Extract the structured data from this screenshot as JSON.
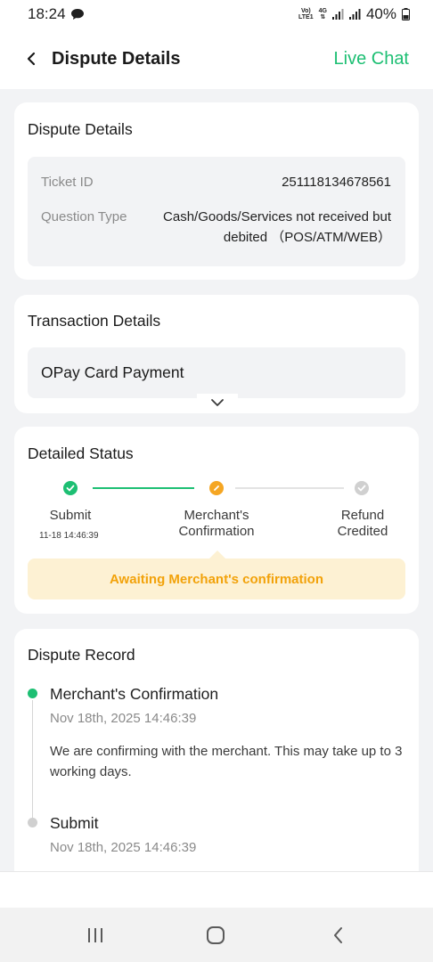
{
  "status_bar": {
    "time": "18:24",
    "network_top": "Vo)",
    "network_bottom": "LTE1",
    "network_type": "4G",
    "battery": "40%"
  },
  "header": {
    "title": "Dispute Details",
    "live_chat": "Live Chat",
    "accent_color": "#1dbf73"
  },
  "dispute": {
    "title": "Dispute Details",
    "ticket_label": "Ticket ID",
    "ticket_value": "251118134678561",
    "question_label": "Question Type",
    "question_value": "Cash/Goods/Services not received but debited （POS/ATM/WEB）"
  },
  "transaction": {
    "title": "Transaction Details",
    "item": "OPay Card Payment"
  },
  "status": {
    "title": "Detailed Status",
    "steps": [
      {
        "label": "Submit",
        "time": "11-18 14:46:39",
        "state": "done"
      },
      {
        "label": "Merchant's Confirmation",
        "time": "",
        "state": "current"
      },
      {
        "label": "Refund Credited",
        "time": "",
        "state": "pending"
      }
    ],
    "banner": "Awaiting Merchant's confirmation",
    "colors": {
      "done": "#1dbf73",
      "current": "#f5a623",
      "pending": "#d0d0d0"
    }
  },
  "record": {
    "title": "Dispute Record",
    "entries": [
      {
        "title": "Merchant's Confirmation",
        "time": "Nov 18th, 2025 14:46:39",
        "desc": "We are confirming with the merchant. This may take up to 3 working days."
      },
      {
        "title": "Submit",
        "time": "Nov 18th, 2025 14:46:39",
        "desc": ""
      }
    ]
  },
  "nav": {
    "recent": "recent-apps-icon",
    "home": "home-icon",
    "back": "back-icon"
  }
}
